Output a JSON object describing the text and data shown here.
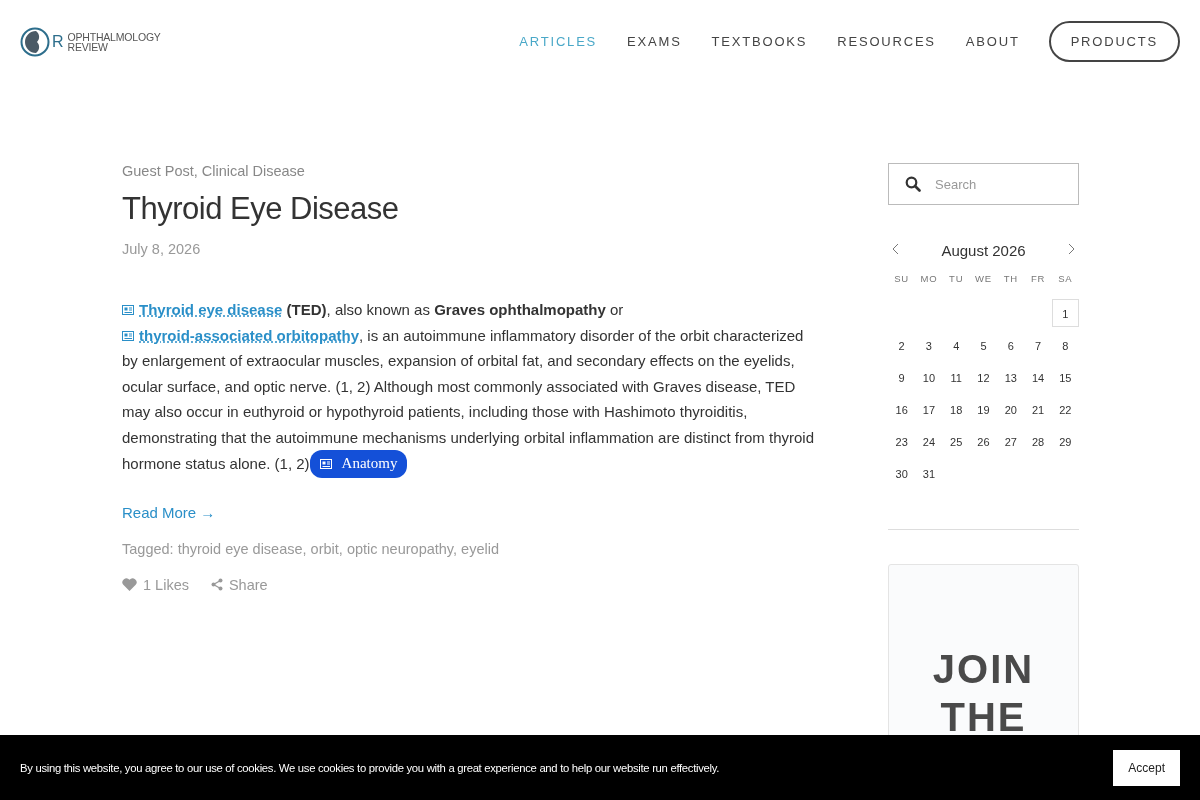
{
  "logo": {
    "mark": "R",
    "line1": "OPHTHALMOLOGY",
    "line2": "REVIEW"
  },
  "nav": [
    {
      "label": "ARTICLES",
      "selected": true
    },
    {
      "label": "EXAMS",
      "selected": false
    },
    {
      "label": "TEXTBOOKS",
      "selected": false
    },
    {
      "label": "RESOURCES",
      "selected": false
    },
    {
      "label": "ABOUT",
      "selected": false
    }
  ],
  "nav_button": "PRODUCTS",
  "post": {
    "categories": "Guest Post, Clinical Disease",
    "title": "Thyroid Eye Disease",
    "date": "July 8, 2026",
    "body": [
      {
        "kind": "link",
        "text": "Thyroid eye disease"
      },
      {
        "kind": "text",
        "text": " **(TED)**, also known as **Graves ophthalmopathy** or "
      },
      {
        "kind": "link",
        "text": "thyroid-associated orbitopathy"
      },
      {
        "kind": "text",
        "text": ", is an autoimmune inflammatory disorder of the orbit characterized by enlargement of extraocular muscles, expansion of orbital fat, and secondary effects on the eyelids, ocular surface, and optic nerve. (1, 2) Although most commonly associated with Graves disease, TED may also occur in euthyroid or hypothyroid patients, including those with Hashimoto thyroiditis, demonstrating that the autoimmune mechanisms underlying orbital inflammation are distinct from thyroid hormone status alone. (1, 2)"
      },
      {
        "kind": "badge",
        "text": "Anatomy"
      }
    ],
    "read_more": "Read More →",
    "tags": "Tagged: thyroid eye disease, orbit, optic neuropathy, eyelid",
    "likes": "1 Likes",
    "share": "Share"
  },
  "search": {
    "placeholder": "Search"
  },
  "calendar": {
    "title": "August 2026",
    "weekdays": [
      "SU",
      "MO",
      "TU",
      "WE",
      "TH",
      "FR",
      "SA"
    ],
    "weeks": [
      [
        {
          "day": "1",
          "today": true
        }
      ],
      [
        {
          "day": "2",
          "today": false
        },
        {
          "day": "3",
          "today": false
        },
        {
          "day": "4",
          "today": false
        },
        {
          "day": "5",
          "today": false
        },
        {
          "day": "6",
          "today": false
        },
        {
          "day": "7",
          "today": false
        },
        {
          "day": "8",
          "today": false
        }
      ],
      [
        {
          "day": "9",
          "today": false
        },
        {
          "day": "10",
          "today": false
        },
        {
          "day": "11",
          "today": false
        },
        {
          "day": "12",
          "today": false
        },
        {
          "day": "13",
          "today": false
        },
        {
          "day": "14",
          "today": false
        },
        {
          "day": "15",
          "today": false
        }
      ],
      [
        {
          "day": "16",
          "today": false
        },
        {
          "day": "17",
          "today": false
        },
        {
          "day": "18",
          "today": false
        },
        {
          "day": "19",
          "today": false
        },
        {
          "day": "20",
          "today": false
        },
        {
          "day": "21",
          "today": false
        },
        {
          "day": "22",
          "today": false
        }
      ],
      [
        {
          "day": "23",
          "today": false
        },
        {
          "day": "24",
          "today": false
        },
        {
          "day": "25",
          "today": false
        },
        {
          "day": "26",
          "today": false
        },
        {
          "day": "27",
          "today": false
        },
        {
          "day": "28",
          "today": false
        },
        {
          "day": "29",
          "today": false
        }
      ],
      [
        {
          "day": "30",
          "today": false
        },
        {
          "day": "31",
          "today": false
        }
      ]
    ]
  },
  "promo": {
    "heading": "JOIN THE"
  },
  "cookie": {
    "text": "By using this website, you agree to our use of cookies. We use cookies to provide you with a great experience and to help our website run effectively.",
    "button": "Accept"
  }
}
